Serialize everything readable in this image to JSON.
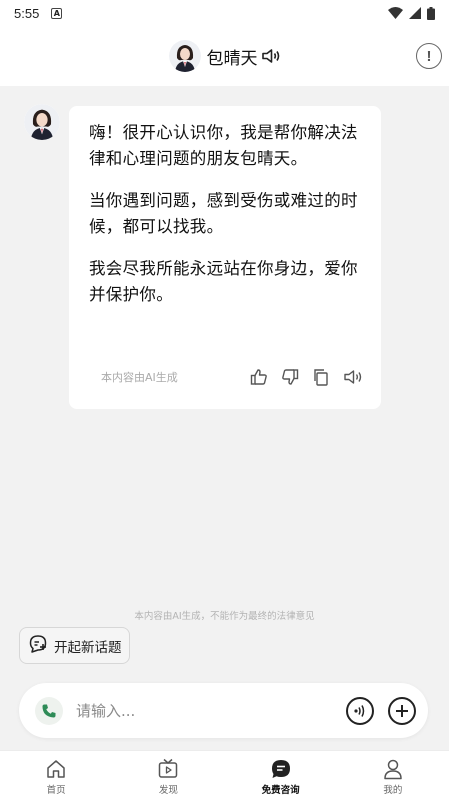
{
  "status_bar": {
    "time": "5:55",
    "notification_icon": "A"
  },
  "header": {
    "title": "包晴天",
    "speaker_icon": "speaker-icon",
    "info_icon": "!"
  },
  "chat": {
    "messages": [
      {
        "paragraphs": [
          "嗨！很开心认识你，我是帮你解决法律和心理问题的朋友包晴天。",
          "当你遇到问题，感到受伤或难过的时候，都可以找我。",
          "我会尽我所能永远站在你身边，爱你并保护你。"
        ],
        "ai_note": "本内容由AI生成"
      }
    ],
    "disclaimer": "本内容由AI生成，不能作为最终的法律意见",
    "new_topic_label": "开起新话题"
  },
  "input": {
    "placeholder": "请输入..."
  },
  "tabs": [
    {
      "label": "首页",
      "icon": "home-icon"
    },
    {
      "label": "发现",
      "icon": "tv-icon"
    },
    {
      "label": "免费咨询",
      "icon": "chat-icon",
      "active": true
    },
    {
      "label": "我的",
      "icon": "person-icon"
    }
  ]
}
